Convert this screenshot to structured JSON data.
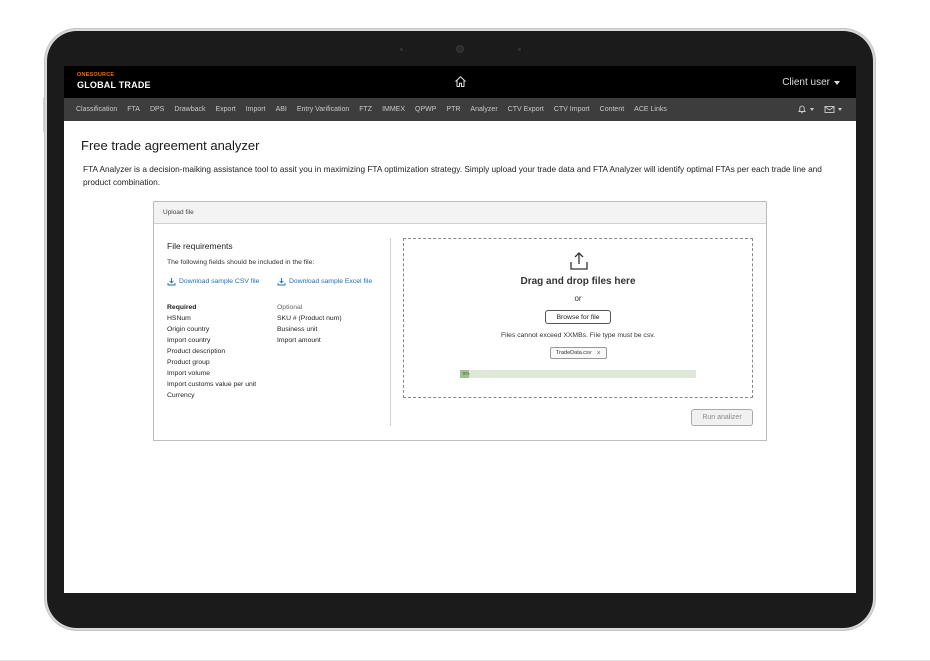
{
  "app": {
    "brand_top": "ONESOURCE",
    "brand_bottom": "GLOBAL TRADE",
    "user_menu": "Client user"
  },
  "nav": {
    "items": [
      "Classification",
      "FTA",
      "DPS",
      "Drawback",
      "Export",
      "Import",
      "ABI",
      "Entry Varification",
      "FTZ",
      "IMMEX",
      "QPWP",
      "PTR",
      "Analyzer",
      "CTV Export",
      "CTV Import",
      "Content",
      "ACE Links"
    ]
  },
  "page": {
    "title": "Free trade agreement analyzer",
    "intro": "FTA Analyzer is a decision-maiking assistance tool to assit you in maximizing FTA optimization strategy. Simply upload your trade data and FTA Analyzer will identify optimal FTAs per each trade line and product combination."
  },
  "upload_card": {
    "header": "Upload file",
    "requirements_title": "File requirements",
    "requirements_sub": "The following fields should be included in the file:",
    "download_csv": "Download sample CSV file",
    "download_excel": "Download sample Excel file",
    "required_head": "Required",
    "required_fields": [
      "HSNum",
      "Origin country",
      "Import country",
      "Product description",
      "Product group",
      "Import volume",
      "Import customs value per unit",
      "Currency"
    ],
    "optional_head": "Optional",
    "optional_fields": [
      "SKU # (Product num)",
      "Business unit",
      "Import amount"
    ],
    "dropzone_title": "Drag and drop files here",
    "dropzone_or": "or",
    "browse_label": "Browse for file",
    "file_note": "Files cannot exceed XXMBs. File type must be csv.",
    "file_chip": "TradeData.csv",
    "file_chip_close": "×",
    "progress_percent": 4,
    "progress_label": "5%",
    "run_label": "Run analizer"
  },
  "colors": {
    "brand_orange": "#ff6600",
    "link_blue": "#1f6fb2",
    "progress_green": "#9fbf8f"
  },
  "icons": [
    "home-icon",
    "bell-icon",
    "mail-icon",
    "download-icon",
    "upload-icon",
    "close-icon",
    "chevron-down-icon"
  ]
}
